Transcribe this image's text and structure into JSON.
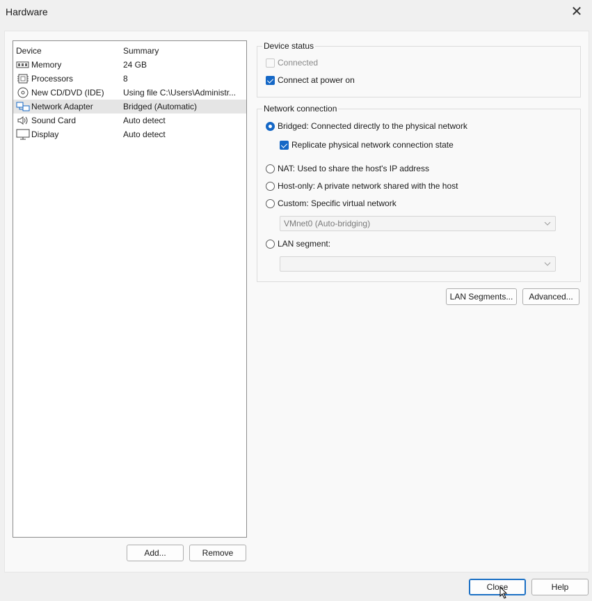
{
  "window": {
    "title": "Hardware"
  },
  "devices": {
    "headers": {
      "device": "Device",
      "summary": "Summary"
    },
    "rows": [
      {
        "device": "Memory",
        "summary": "24 GB",
        "icon": "memory-icon"
      },
      {
        "device": "Processors",
        "summary": "8",
        "icon": "processor-icon"
      },
      {
        "device": "New CD/DVD (IDE)",
        "summary": "Using file C:\\Users\\Administr...",
        "icon": "cd-dvd-icon"
      },
      {
        "device": "Network Adapter",
        "summary": "Bridged (Automatic)",
        "icon": "network-adapter-icon"
      },
      {
        "device": "Sound Card",
        "summary": "Auto detect",
        "icon": "sound-card-icon"
      },
      {
        "device": "Display",
        "summary": "Auto detect",
        "icon": "display-icon"
      }
    ],
    "add_label": "Add...",
    "remove_label": "Remove"
  },
  "device_status": {
    "label": "Device status",
    "connected": "Connected",
    "connect_power_on": "Connect at power on"
  },
  "network": {
    "label": "Network connection",
    "bridged": "Bridged: Connected directly to the physical network",
    "replicate": "Replicate physical network connection state",
    "nat": "NAT: Used to share the host's IP address",
    "host_only": "Host-only: A private network shared with the host",
    "custom": "Custom: Specific virtual network",
    "custom_value": "VMnet0 (Auto-bridging)",
    "lan_segment": "LAN segment:",
    "lan_segment_value": ""
  },
  "buttons": {
    "lan_segments": "LAN Segments...",
    "advanced": "Advanced...",
    "close": "Close",
    "help": "Help"
  },
  "colors": {
    "accent": "#1467c6"
  }
}
